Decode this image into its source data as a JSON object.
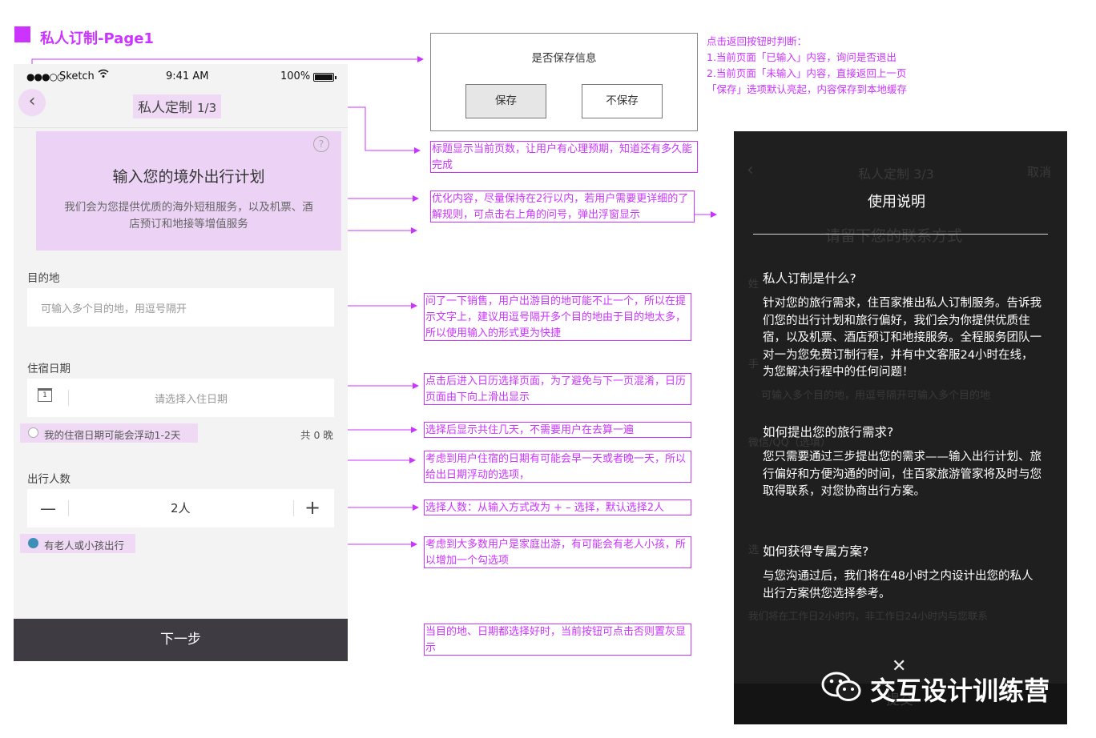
{
  "page_title": "私人订制-Page1",
  "phone": {
    "status": {
      "signal": "●●●○○",
      "carrier": "Sketch",
      "time": "9:41 AM",
      "battery": "100%"
    },
    "nav": {
      "back": "‹",
      "title": "私人定制",
      "step": "1/3"
    },
    "intro": {
      "help": "?",
      "title": "输入您的境外出行计划",
      "desc": "我们会为您提供优质的海外短租服务，以及机票、酒店预订和地接等增值服务"
    },
    "destination": {
      "label": "目的地",
      "placeholder": "可输入多个目的地，用逗号隔开"
    },
    "stay": {
      "label": "住宿日期",
      "calendar_day": "1",
      "placeholder": "请选择入住日期",
      "float_option": "我的住宿日期可能会浮动1-2天",
      "nights": "共 0 晚"
    },
    "travelers": {
      "label": "出行人数",
      "minus": "—",
      "value": "2人",
      "plus": "+",
      "elder_option": "有老人或小孩出行"
    },
    "next_button": "下一步"
  },
  "dialog": {
    "title": "是否保存信息",
    "save": "保存",
    "no_save": "不保存"
  },
  "dialog_note": [
    "点击返回按钮时判断：",
    "1.当前页面「已输入」内容，询问是否退出",
    "2.当前页面「未输入」内容，直接返回上一页",
    "「保存」选项默认亮起，内容保存到本地缓存"
  ],
  "annotations": {
    "title": "标题显示当前页数，让用户有心理预期，知道还有多久能完成",
    "intro": "优化内容，尽量保持在2行以内，若用户需要更详细的了解规则，可点击右上角的问号，弹出浮窗显示",
    "destination": "问了一下销售，用户出游目的地可能不止一个，所以在提示文字上，建议用逗号隔开多个目的地由于目的地太多，所以使用输入的形式更为快捷",
    "calendar": "点击后进入日历选择页面，为了避免与下一页混淆，日历页面由下向上滑出显示",
    "nights": "选择后显示共住几天，不需要用户在去算一遍",
    "float": "考虑到用户住宿的日期有可能会早一天或者晚一天，所以给出日期浮动的选项，",
    "travelers": "选择人数：从输入方式改为 + – 选择，默认选择2人",
    "elder": "考虑到大多数用户是家庭出游，有可能会有老人小孩，所以增加一个勾选项",
    "next": "当目的地、日期都选择好时，当前按钮可点击否则置灰显示"
  },
  "help_panel": {
    "bg_back": "‹",
    "bg_title": "私人定制 3/3",
    "bg_cancel": "取消",
    "bg_contact": "请留下您的联系方式",
    "bg_name": "姓",
    "bg_hand": "手",
    "bg_dest_line": "可输入多个目的地，用逗号隔开可输入多个目的地",
    "bg_wechat": "微信/QQ（选填）",
    "bg_choose": "选",
    "bg_footer": "我们将在工作日2小时内，非工作日24小时内与您联系",
    "bg_submit": "提交",
    "title": "使用说明",
    "sections": [
      {
        "q": "私人订制是什么?",
        "a": "针对您的旅行需求，住百家推出私人订制服务。告诉我们您的出行计划和旅行偏好，我们会为你提供优质住宿，以及机票、酒店预订和地接服务。全程服务团队一对一为您免费订制行程，并有中文客服24小时在线，为您解决行程中的任何问题！"
      },
      {
        "q": "如何提出您的旅行需求?",
        "a": "您只需要通过三步提出您的需求——输入出行计划、旅行偏好和方便沟通的时间，住百家旅游管家将及时与您取得联系，对您协商出行方案。"
      },
      {
        "q": "如何获得专属方案?",
        "a": "与您沟通过后，我们将在48小时之内设计出您的私人出行方案供您选择参考。"
      }
    ]
  },
  "watermark": {
    "close": "✕",
    "text": "交互设计训练营"
  }
}
